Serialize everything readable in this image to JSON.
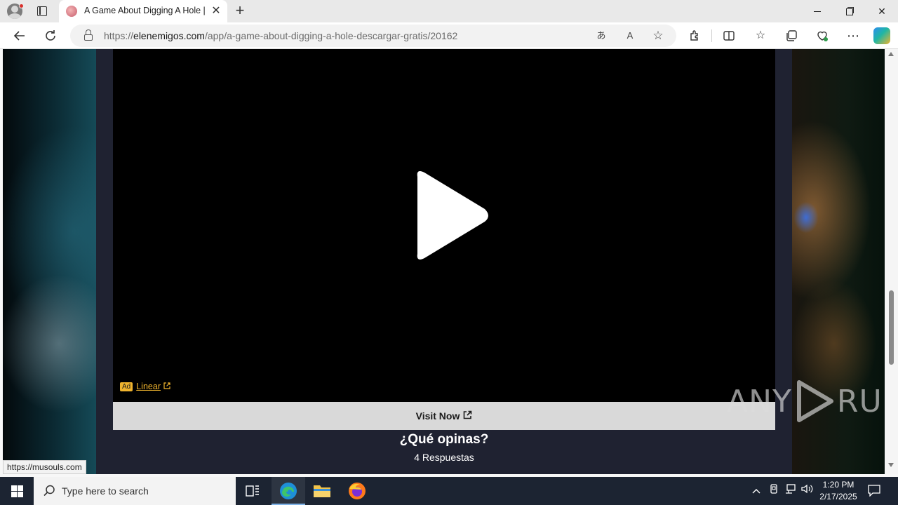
{
  "browser": {
    "tab": {
      "title": "A Game About Digging A Hole | E",
      "close_glyph": "✕"
    },
    "new_tab_glyph": "+",
    "url": {
      "scheme": "https://",
      "host": "elenemigos.com",
      "path": "/app/a-game-about-digging-a-hole-descargar-gratis/20162"
    },
    "status_url": "https://musouls.com"
  },
  "page": {
    "ad": {
      "badge": "Ad",
      "link_text": "Linear"
    },
    "visit_button": "Visit Now",
    "comments_title": "¿Qué opinas?",
    "comments_count": "4 Respuestas"
  },
  "watermark": {
    "left": "ANY",
    "right": "RUN"
  },
  "taskbar": {
    "search_placeholder": "Type here to search",
    "time": "1:20 PM",
    "date": "2/17/2025"
  },
  "colors": {
    "ad_accent": "#f0b42e",
    "page_bg": "#1f2231",
    "taskbar_bg": "#1c2432"
  }
}
